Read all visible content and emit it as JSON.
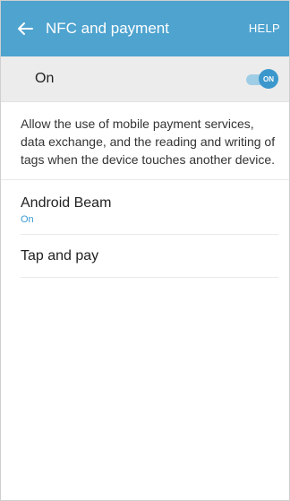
{
  "app_bar": {
    "title": "NFC and payment",
    "help_label": "HELP",
    "back_icon": "arrow-left-icon"
  },
  "master_switch": {
    "label": "On",
    "state": "ON",
    "accent_color": "#3c98cc"
  },
  "description": "Allow the use of mobile payment services, data exchange, and the reading and writing of tags when the device touches another device.",
  "items": [
    {
      "title": "Android Beam",
      "status": "On"
    },
    {
      "title": "Tap and pay"
    }
  ],
  "colors": {
    "app_bar": "#4ea3cf",
    "master_bg": "#ececec",
    "status_text": "#3a9bd0"
  }
}
